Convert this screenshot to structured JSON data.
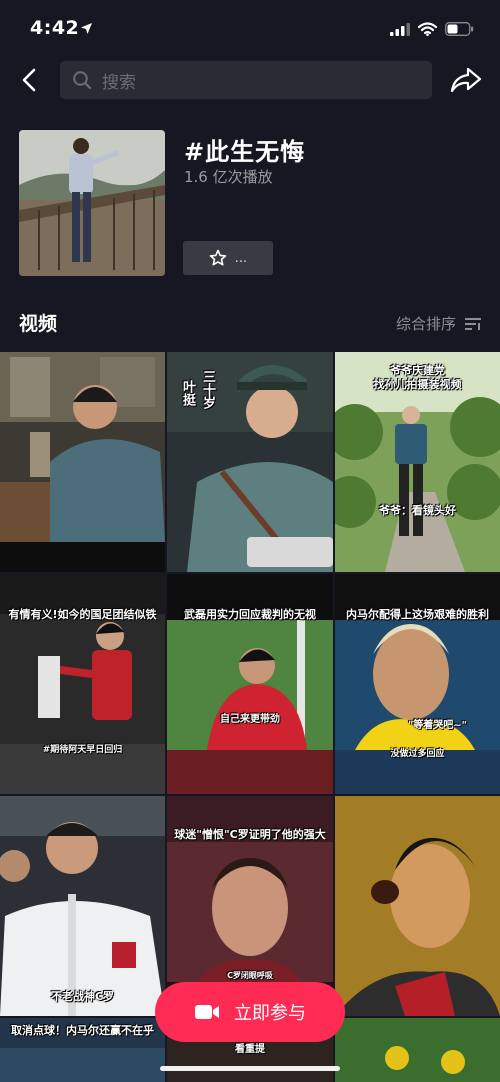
{
  "status": {
    "time": "4:42"
  },
  "search": {
    "placeholder": "搜索"
  },
  "hashtag": {
    "title": "#此生无悔",
    "plays": "1.6 亿次播放",
    "fav_label": "..."
  },
  "section": {
    "title": "视频",
    "sort_label": "综合排序"
  },
  "videos": [
    {
      "caption": ""
    },
    {
      "caption": "三十岁",
      "caption2": "叶挺"
    },
    {
      "caption": "爷爷庆建党",
      "caption2": "找孙儿拍摄装视频",
      "caption3": "爷爷：看镜头好"
    },
    {
      "caption": "有情有义!如今的国足团结似铁",
      "caption2": "#期待阿天早日回归"
    },
    {
      "caption": "武磊用实力回应裁判的无视",
      "caption2": "自己来更带劲"
    },
    {
      "caption": "内马尔配得上这场艰难的胜利",
      "caption2": "\"等着哭吧~\"",
      "caption3": "没做过多回应"
    },
    {
      "caption": "不老战神C罗"
    },
    {
      "caption": "球迷\"憎恨\"C罗证明了他的强大",
      "caption2": "C罗闭眼呼吸"
    },
    {
      "caption": ""
    },
    {
      "caption": "取消点球！内马尔还赢不在乎"
    },
    {
      "caption": "看重提"
    },
    {
      "caption": ""
    }
  ],
  "cta": {
    "label": "立即参与"
  },
  "colors": {
    "accent": "#fe2c55",
    "background": "#161722"
  }
}
